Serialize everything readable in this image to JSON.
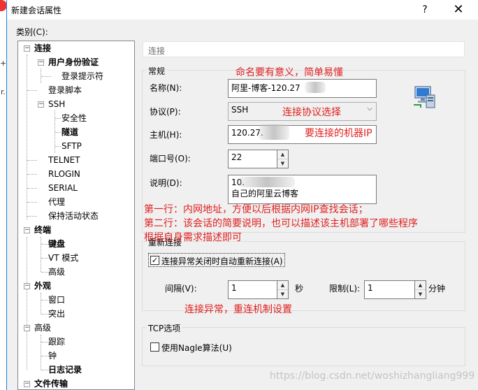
{
  "dialog": {
    "title": "新建会话属性",
    "help": "?",
    "close": "✕",
    "category_label": "类别(C):"
  },
  "tree": [
    {
      "label": "连接",
      "bold": true
    },
    {
      "label": "用户身份验证",
      "bold": true
    },
    {
      "label": "登录提示符",
      "bold": false
    },
    {
      "label": "登录脚本",
      "bold": false
    },
    {
      "label": "SSH",
      "bold": false
    },
    {
      "label": "安全性",
      "bold": false
    },
    {
      "label": "隧道",
      "bold": true
    },
    {
      "label": "SFTP",
      "bold": false
    },
    {
      "label": "TELNET",
      "bold": false
    },
    {
      "label": "RLOGIN",
      "bold": false
    },
    {
      "label": "SERIAL",
      "bold": false
    },
    {
      "label": "代理",
      "bold": false
    },
    {
      "label": "保持活动状态",
      "bold": false
    },
    {
      "label": "终端",
      "bold": true
    },
    {
      "label": "键盘",
      "bold": true
    },
    {
      "label": "VT 模式",
      "bold": false
    },
    {
      "label": "高级",
      "bold": false
    },
    {
      "label": "外观",
      "bold": true
    },
    {
      "label": "窗口",
      "bold": false
    },
    {
      "label": "突出",
      "bold": false
    },
    {
      "label": "高级",
      "bold": false
    },
    {
      "label": "跟踪",
      "bold": false
    },
    {
      "label": "钟",
      "bold": false
    },
    {
      "label": "日志记录",
      "bold": true
    },
    {
      "label": "文件传输",
      "bold": true
    }
  ],
  "panel": {
    "section_title": "连接",
    "general_group": "常规",
    "name_label": "名称(N):",
    "name_value": "阿里-博客-120.27",
    "protocol_label": "协议(P):",
    "protocol_value": "SSH",
    "host_label": "主机(H):",
    "host_value": "120.27.",
    "port_label": "端口号(O):",
    "port_value": "22",
    "desc_label": "说明(D):",
    "desc_line1": "10.",
    "desc_line2": "自己的阿里云博客",
    "reconnect_group": "重新连接",
    "reconnect_checkbox": "连接异常关闭时自动重新连接(A)",
    "interval_label": "间隔(V):",
    "interval_value": "1",
    "interval_unit": "秒",
    "limit_label": "限制(L):",
    "limit_value": "1",
    "limit_unit": "分钟",
    "tcp_group": "TCP选项",
    "nagle_checkbox": "使用Nagle算法(U)"
  },
  "annotations": {
    "name": "命名要有意义，简单易懂",
    "protocol": "连接协议选择",
    "host": "要连接的机器IP",
    "desc_line1": "第一行：内网地址，方便以后根据内网IP查找会话；",
    "desc_line2": "第二行：该会话的简要说明，也可以描述该主机部署了哪些程序",
    "desc_line3": "根据自身需求描述即可",
    "reconnect": "连接异常，重连机制设置"
  },
  "watermark": "https://blog.csdn.net/woshizhangliang999",
  "colors": {
    "annotation": "#e02020",
    "dialog_bg": "#f0f0f0",
    "title_border": "#1883d7"
  }
}
